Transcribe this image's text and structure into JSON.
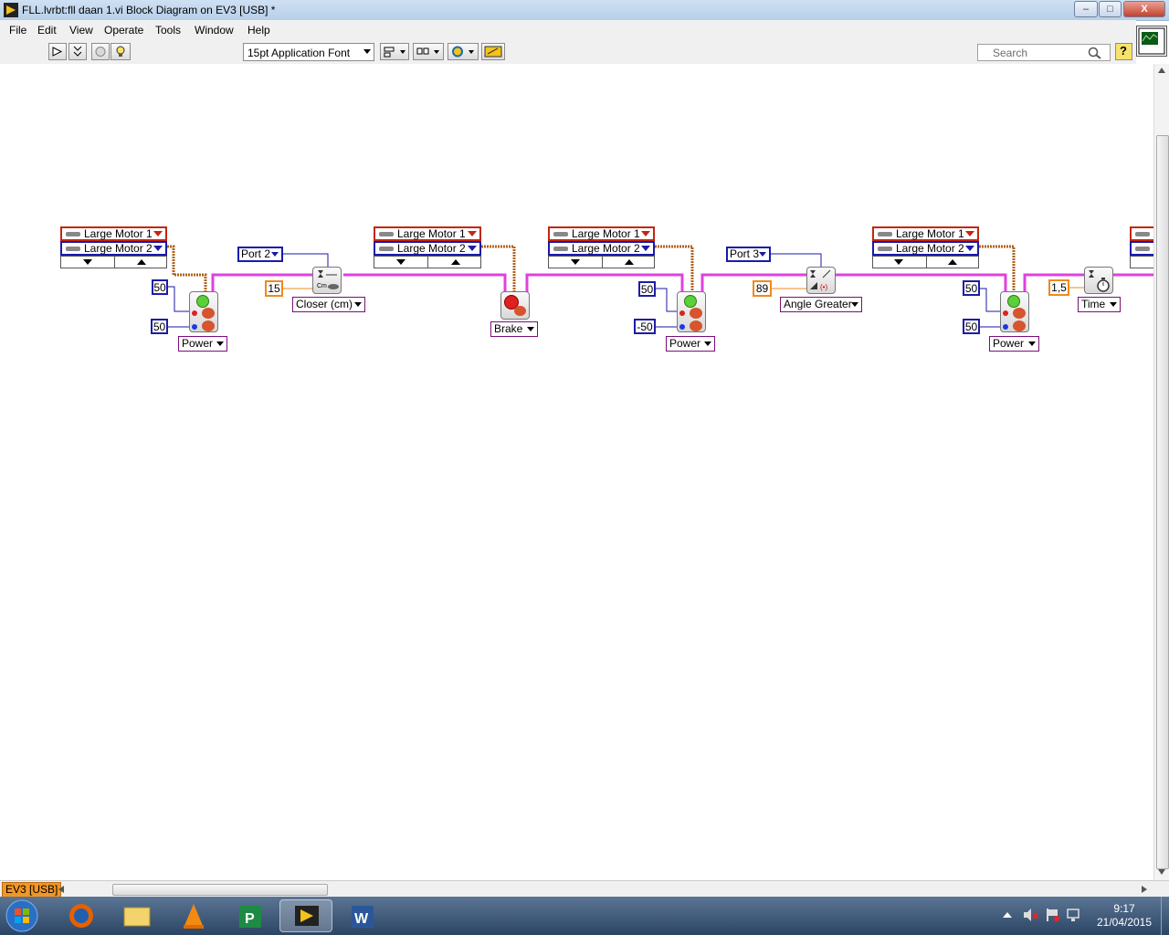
{
  "window": {
    "title": "FLL.lvrbt:fll daan 1.vi Block Diagram on EV3 [USB] *",
    "controls": {
      "minimize": "–",
      "maximize": "□",
      "close": "X"
    }
  },
  "menu": [
    "File",
    "Edit",
    "View",
    "Operate",
    "Tools",
    "Window",
    "Help"
  ],
  "toolbar": {
    "font_select": "15pt Application Font",
    "search_placeholder": "Search",
    "help_icon": "?"
  },
  "diagram": {
    "motor_group_1": {
      "motor1": "Large Motor 1",
      "motor2": "Large Motor 2"
    },
    "motor_group_2": {
      "motor1": "Large Motor 1",
      "motor2": "Large Motor 2"
    },
    "motor_group_3": {
      "motor1": "Large Motor 1",
      "motor2": "Large Motor 2"
    },
    "motor_group_4": {
      "motor1": "Large Motor 1",
      "motor2": "Large Motor 2"
    },
    "block1": {
      "in1": "50",
      "in2": "50",
      "mode": "Power"
    },
    "wait1": {
      "port": "Port 2",
      "value": "15",
      "mode": "Closer (cm)"
    },
    "block2": {
      "mode": "Brake"
    },
    "block3": {
      "in1": "50",
      "in2": "-50",
      "mode": "Power"
    },
    "wait2": {
      "port": "Port 3",
      "value": "89",
      "mode": "Angle Greater"
    },
    "block4": {
      "in1": "50",
      "in2": "50",
      "mode": "Power"
    },
    "wait3": {
      "value": "1,5",
      "mode": "Time"
    }
  },
  "status": {
    "target": "EV3 [USB]"
  },
  "taskbar": {
    "time": "9:17",
    "date": "21/04/2015"
  },
  "colors": {
    "wire_pink": "#e040e0",
    "wire_brown": "#b0621a",
    "ctl_blue": "#1a1aa8",
    "ctl_orange": "#f08a1c",
    "motor_red": "#c4260f"
  }
}
